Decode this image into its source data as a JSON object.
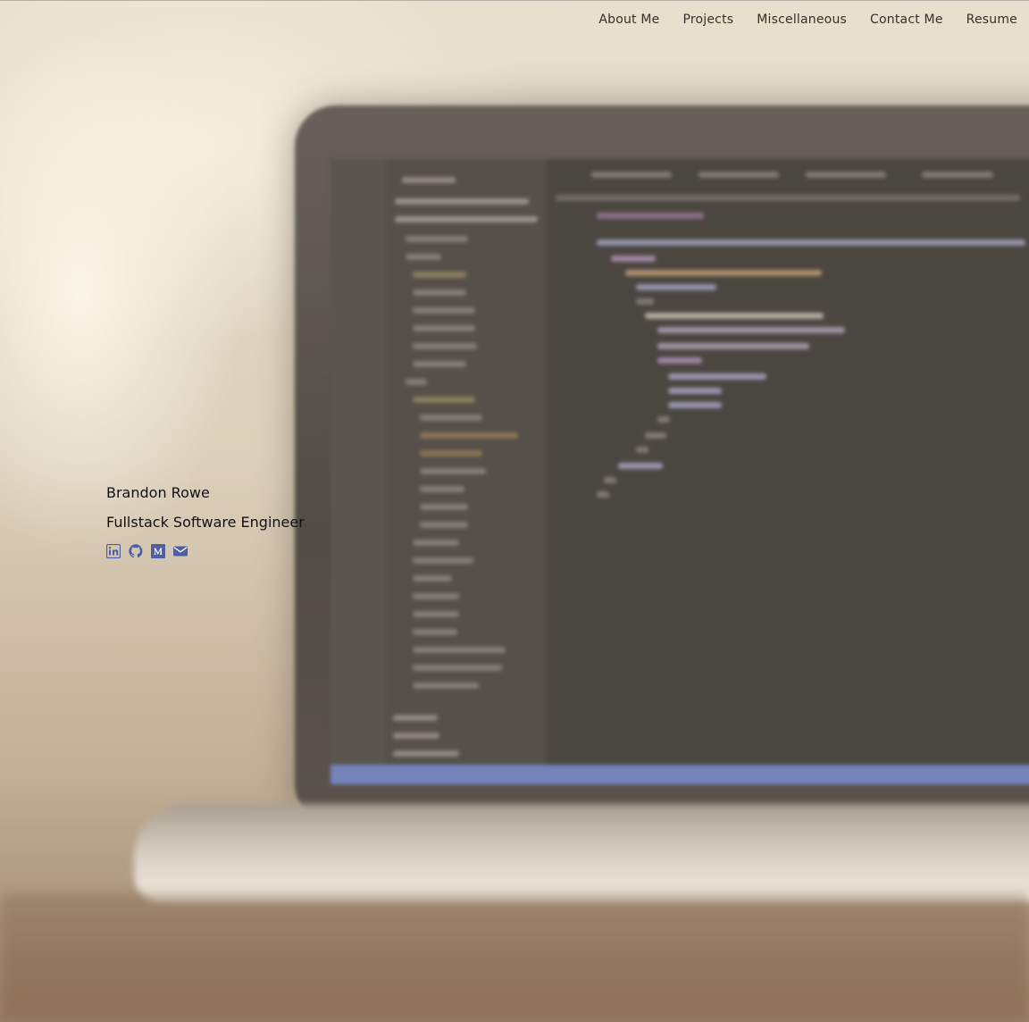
{
  "nav": {
    "items": [
      {
        "label": "About Me"
      },
      {
        "label": "Projects"
      },
      {
        "label": "Miscellaneous"
      },
      {
        "label": "Contact Me"
      },
      {
        "label": "Resume"
      }
    ]
  },
  "hero": {
    "name": "Brandon Rowe",
    "title": "Fullstack Software Engineer"
  },
  "socials": [
    {
      "icon": "linkedin-icon"
    },
    {
      "icon": "github-icon"
    },
    {
      "icon": "medium-icon"
    },
    {
      "icon": "envelope-icon"
    }
  ],
  "colors": {
    "icon": "#4f5ea3",
    "nav_text": "#3a2d2a",
    "hero_text": "#111111"
  }
}
